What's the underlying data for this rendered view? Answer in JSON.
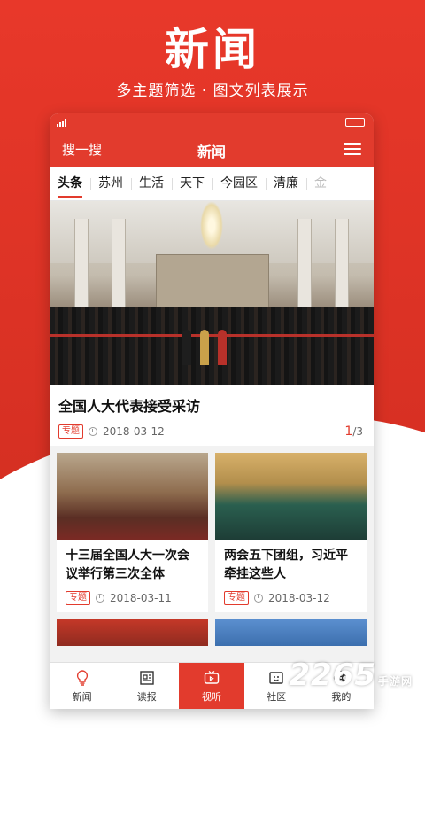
{
  "promo": {
    "title": "新闻",
    "subtitle": "多主题筛选 · 图文列表展示"
  },
  "navbar": {
    "search_label": "搜一搜",
    "title": "新闻"
  },
  "tabs": [
    "头条",
    "苏州",
    "生活",
    "天下",
    "今园区",
    "清廉",
    "金"
  ],
  "headline": {
    "title": "全国人大代表接受采访",
    "tag": "专题",
    "date": "2018-03-12",
    "page_current": "1",
    "page_total": "/3"
  },
  "cards": [
    {
      "title": "十三届全国人大一次会议举行第三次全体",
      "tag": "专题",
      "date": "2018-03-11"
    },
    {
      "title": "两会五下团组，习近平牵挂这些人",
      "tag": "专题",
      "date": "2018-03-12"
    }
  ],
  "bottom_nav": [
    {
      "label": "新闻",
      "icon": "lightbulb-icon"
    },
    {
      "label": "读报",
      "icon": "newspaper-icon"
    },
    {
      "label": "视听",
      "icon": "tv-icon"
    },
    {
      "label": "社区",
      "icon": "community-icon"
    },
    {
      "label": "我的",
      "icon": "flower-icon"
    }
  ],
  "watermark": {
    "text": "2265",
    "suffix": "手游网"
  },
  "colors": {
    "accent": "#e23b2d",
    "background_top": "#d52f22"
  }
}
